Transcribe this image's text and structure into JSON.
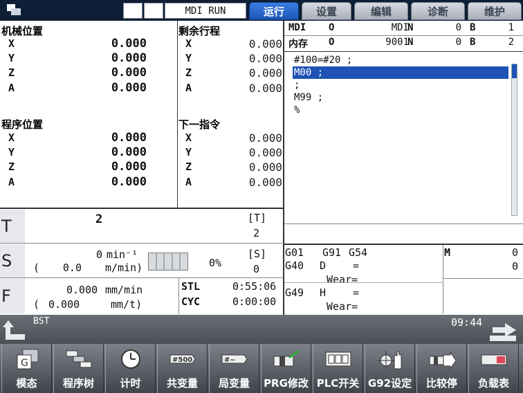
{
  "topbar": {
    "mode": "MDI RUN",
    "tabs": [
      {
        "label": "运行",
        "active": true
      },
      {
        "label": "设置",
        "active": false
      },
      {
        "label": "编辑",
        "active": false
      },
      {
        "label": "诊断",
        "active": false
      },
      {
        "label": "维护",
        "active": false
      }
    ]
  },
  "machine_pos": {
    "title": "机械位置",
    "axes": [
      {
        "name": "X",
        "value": "0.000"
      },
      {
        "name": "Y",
        "value": "0.000"
      },
      {
        "name": "Z",
        "value": "0.000"
      },
      {
        "name": "A",
        "value": "0.000"
      }
    ]
  },
  "remaining": {
    "title": "剩余行程",
    "axes": [
      {
        "name": "X",
        "value": "0.000"
      },
      {
        "name": "Y",
        "value": "0.000"
      },
      {
        "name": "Z",
        "value": "0.000"
      },
      {
        "name": "A",
        "value": "0.000"
      }
    ]
  },
  "program_pos": {
    "title": "程序位置",
    "axes": [
      {
        "name": "X",
        "value": "0.000"
      },
      {
        "name": "Y",
        "value": "0.000"
      },
      {
        "name": "Z",
        "value": "0.000"
      },
      {
        "name": "A",
        "value": "0.000"
      }
    ]
  },
  "next_cmd": {
    "title": "下一指令",
    "axes": [
      {
        "name": "X",
        "value": "0.000"
      },
      {
        "name": "Y",
        "value": "0.000"
      },
      {
        "name": "Z",
        "value": "0.000"
      },
      {
        "name": "A",
        "value": "0.000"
      }
    ]
  },
  "prog_header": {
    "row1": {
      "label": "MDI",
      "o": "O",
      "prog": "MDI",
      "n": "N",
      "nval": "0",
      "b": "B",
      "bval": "1"
    },
    "row2": {
      "label": "内存",
      "o": "O",
      "prog": "9001",
      "n": "N",
      "nval": "0",
      "b": "B",
      "bval": "2"
    }
  },
  "program_lines": [
    "#100=#20 ;",
    "M00 ;",
    ";",
    "M99 ;",
    "%"
  ],
  "selected_line": 1,
  "tool": {
    "label": "T",
    "value": "2",
    "bracket": "[T]",
    "bracket_value": "2"
  },
  "spindle": {
    "label": "S",
    "speed": "0",
    "speed_unit": "min⁻¹",
    "surface": "0.0",
    "surface_unit": "m/min)",
    "paren_open": "(",
    "load": "0%",
    "bracket": "[S]",
    "bracket_value": "0"
  },
  "feed": {
    "label": "F",
    "value": "0.000",
    "unit": "mm/min",
    "paren_open": "(",
    "value2": "0.000",
    "unit2": "mm/t)",
    "stl_label": "STL",
    "stl_time": "0:55:06",
    "cyc_label": "CYC",
    "cyc_time": "0:00:00"
  },
  "modal": {
    "row1": [
      "G01",
      "G91",
      "G54"
    ],
    "row2": [
      "G40",
      "D",
      "="
    ],
    "row2b": "Wear=",
    "row3": [
      "G49",
      "H",
      "="
    ],
    "row3b": "Wear=",
    "m_label": "M",
    "m_values": [
      "0",
      "0"
    ]
  },
  "bst": {
    "label": "BST",
    "clock": "09:44"
  },
  "softkeys": [
    {
      "label": "模态",
      "icon": "g-code-icon"
    },
    {
      "label": "程序树",
      "icon": "program-tree-icon"
    },
    {
      "label": "计时",
      "icon": "clock-icon"
    },
    {
      "label": "共变量",
      "icon": "common-variable-icon"
    },
    {
      "label": "局变量",
      "icon": "local-variable-icon"
    },
    {
      "label": "PRG修改",
      "icon": "program-edit-icon"
    },
    {
      "label": "PLC开关",
      "icon": "plc-switch-icon"
    },
    {
      "label": "G92设定",
      "icon": "g92-set-icon"
    },
    {
      "label": "比较停",
      "icon": "compare-stop-icon"
    },
    {
      "label": "负载表",
      "icon": "load-meter-icon"
    }
  ]
}
